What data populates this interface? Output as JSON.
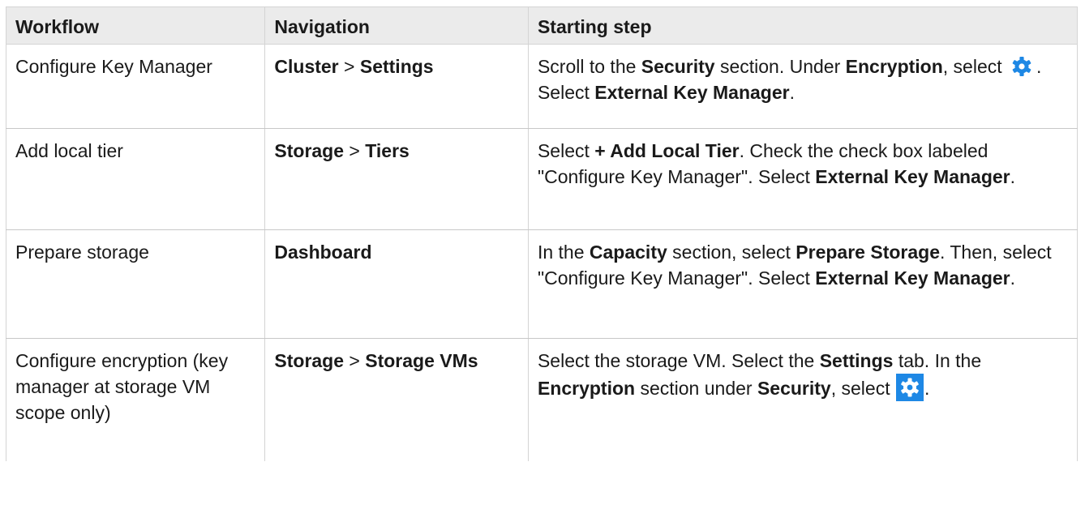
{
  "headers": {
    "workflow": "Workflow",
    "navigation": "Navigation",
    "starting_step": "Starting step"
  },
  "rows": [
    {
      "workflow": "Configure Key Manager",
      "nav": {
        "a": "Cluster",
        "sep": " > ",
        "b": "Settings"
      },
      "step": {
        "t1": "Scroll to the ",
        "b1": "Security",
        "t2": " section. Under ",
        "b2": "Encryption",
        "t3": ", select ",
        "t4": ". Select ",
        "b3": "External Key Manager",
        "t5": "."
      }
    },
    {
      "workflow": "Add local tier",
      "nav": {
        "a": "Storage",
        "sep": " > ",
        "b": "Tiers"
      },
      "step": {
        "t1": "Select ",
        "b1": "+ Add Local Tier",
        "t2": ". Check the check box labeled \"Configure Key Manager\". Select ",
        "b2": "External Key Manager",
        "t3": "."
      }
    },
    {
      "workflow": "Prepare storage",
      "nav": {
        "a": "Dashboard"
      },
      "step": {
        "t1": "In the ",
        "b1": "Capacity",
        "t2": " section, select ",
        "b2": "Prepare Storage",
        "t3": ". Then, select \"Configure Key Manager\". Select ",
        "b3": "External Key Manager",
        "t4": "."
      }
    },
    {
      "workflow": "Configure encryption (key manager at storage VM scope only)",
      "nav": {
        "a": "Storage",
        "sep": " > ",
        "b": "Storage VMs"
      },
      "step": {
        "t1": "Select the storage VM. Select the ",
        "b1": "Settings",
        "t2": " tab. In the ",
        "b2": "Encryption",
        "t3": " section under ",
        "b3": "Security",
        "t4": ", select ",
        "t5": "."
      }
    }
  ],
  "icons": {
    "gear": "gear-icon",
    "gear_color": "#1e88e5",
    "gear_box_color": "#1e88e5"
  }
}
